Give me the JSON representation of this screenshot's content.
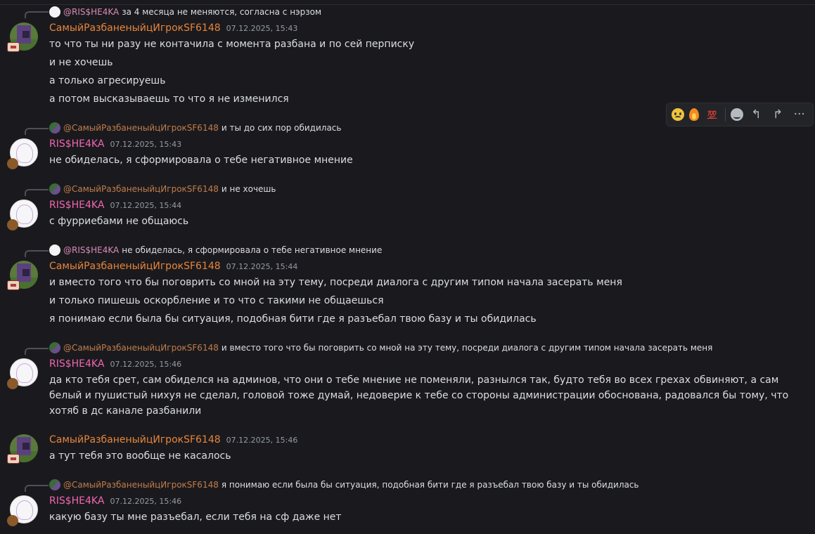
{
  "users": {
    "a": "СамыйРазбаненыйцИгрокSF6148",
    "b": "RIS$HE4KA",
    "reply_a": "@СамыйРазбаненыйцИгрокSF6148",
    "reply_b": "@RIS$HE4KA"
  },
  "colors": {
    "user_a": "#e8853a",
    "user_b": "#f266b0",
    "background": "#1a1a1e"
  },
  "toolbar": {
    "icons": [
      "cold-sweat-emoji-icon",
      "fire-emoji-icon",
      "hundred-emoji-icon",
      "add-reaction-icon",
      "reply-icon",
      "forward-icon",
      "more-icon"
    ],
    "hundred_label": "💯",
    "reply_glyph": "↰",
    "forward_glyph": "↱",
    "more_glyph": "···"
  },
  "messages": [
    {
      "reply_to": "@RIS$HE4KA",
      "reply_text": "за 4 месяца не меняются, согласна с нэрзом",
      "author": "СамыйРазбаненыйцИгрокSF6148",
      "time": "07.12.2025, 15:43",
      "lines": [
        "то что ты ни разу не контачила с момента разбана и по сей перпиcку",
        "и не хочешь",
        "а только агресируешь",
        "а потом высказываешь то что я не изменился"
      ]
    },
    {
      "reply_to": "@СамыйРазбаненыйцИгрокSF6148",
      "reply_text": "и ты до сих пор обидилась",
      "author": "RIS$HE4KA",
      "time": "07.12.2025, 15:43",
      "lines": [
        "не обиделась, я сформировала о тебе негативное мнение"
      ]
    },
    {
      "reply_to": "@СамыйРазбаненыйцИгрокSF6148",
      "reply_text": "и не хочешь",
      "author": "RIS$HE4KA",
      "time": "07.12.2025, 15:44",
      "lines": [
        "с фурриебами не общаюсь"
      ]
    },
    {
      "reply_to": "@RIS$HE4KA",
      "reply_text": "не обиделась, я сформировала о тебе негативное мнение",
      "author": "СамыйРазбаненыйцИгрокSF6148",
      "time": "07.12.2025, 15:44",
      "lines": [
        "и вместо того что бы поговрить со мной на эту тему, посреди диалога с другим типом начала засерать меня",
        "и только пишешь оскорбление и то что с такими не общаешься",
        "я понимаю если была бы ситуация, подобная бити где я разъебал твою базу и ты обидилась"
      ]
    },
    {
      "reply_to": "@СамыйРазбаненыйцИгрокSF6148",
      "reply_text": "и вместо того что бы поговрить со мной на эту тему, посреди диалога с другим типом начала засерать меня",
      "author": "RIS$HE4KA",
      "time": "07.12.2025, 15:46",
      "lines": [
        "да кто тебя срет, сам обиделся на админов, что они о тебе мнение не поменяли, разнылся так, будто тебя во всех грехах обвиняют, а сам белый и пушистый нихуя не сделал, головой тоже думай, недоверие к тебе со стороны администрации обоснована, радовался бы тому, что хотяб в дс канале разбанили"
      ]
    },
    {
      "author": "СамыйРазбаненыйцИгрокSF6148",
      "time": "07.12.2025, 15:46",
      "lines": [
        "а тут тебя это вообще не касалось"
      ]
    },
    {
      "reply_to": "@СамыйРазбаненыйцИгрокSF6148",
      "reply_text": "я понимаю если была бы ситуация, подобная бити где я разъебал твою базу и ты обидилась",
      "author": "RIS$HE4KA",
      "time": "07.12.2025, 15:46",
      "lines": [
        "какую базу ты мне разъебал, если тебя на сф даже нет"
      ]
    }
  ]
}
